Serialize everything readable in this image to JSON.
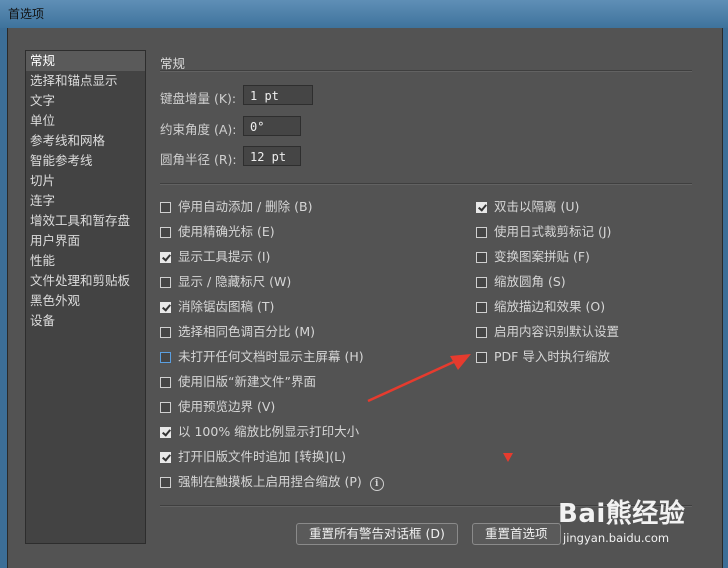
{
  "window": {
    "title": "首选项"
  },
  "sidebar": {
    "items": [
      {
        "label": "常规"
      },
      {
        "label": "选择和锚点显示"
      },
      {
        "label": "文字"
      },
      {
        "label": "单位"
      },
      {
        "label": "参考线和网格"
      },
      {
        "label": "智能参考线"
      },
      {
        "label": "切片"
      },
      {
        "label": "连字"
      },
      {
        "label": "增效工具和暂存盘"
      },
      {
        "label": "用户界面"
      },
      {
        "label": "性能"
      },
      {
        "label": "文件处理和剪贴板"
      },
      {
        "label": "黑色外观"
      },
      {
        "label": "设备"
      }
    ]
  },
  "main": {
    "section_title": "常规",
    "fields": {
      "keyboard_increment": {
        "label": "键盘增量 (K):",
        "value": "1 pt"
      },
      "constrain_angle": {
        "label": "约束角度 (A):",
        "value": "0°"
      },
      "corner_radius": {
        "label": "圆角半径 (R):",
        "value": "12 pt"
      }
    },
    "left_options": [
      {
        "label": "停用自动添加 / 删除 (B)",
        "checked": false
      },
      {
        "label": "使用精确光标 (E)",
        "checked": false
      },
      {
        "label": "显示工具提示 (I)",
        "checked": true
      },
      {
        "label": "显示 / 隐藏标尺 (W)",
        "checked": false
      },
      {
        "label": "消除锯齿图稿 (T)",
        "checked": true
      },
      {
        "label": "选择相同色调百分比 (M)",
        "checked": false
      },
      {
        "label": "未打开任何文档时显示主屏幕 (H)",
        "checked": false
      },
      {
        "label": "使用旧版“新建文件”界面",
        "checked": false
      },
      {
        "label": "使用预览边界 (V)",
        "checked": false
      },
      {
        "label": "以 100% 缩放比例显示打印大小",
        "checked": true
      },
      {
        "label": "打开旧版文件时追加 [转换](L)",
        "checked": true
      },
      {
        "label": "强制在触摸板上启用捏合缩放 (P)",
        "checked": false
      }
    ],
    "right_options": [
      {
        "label": "双击以隔离 (U)",
        "checked": true
      },
      {
        "label": "使用日式裁剪标记 (J)",
        "checked": false
      },
      {
        "label": "变换图案拼贴 (F)",
        "checked": false
      },
      {
        "label": "缩放圆角 (S)",
        "checked": false
      },
      {
        "label": "缩放描边和效果 (O)",
        "checked": false
      },
      {
        "label": "启用内容识别默认设置",
        "checked": false
      },
      {
        "label": "PDF 导入时执行缩放",
        "checked": false
      }
    ],
    "buttons": {
      "reset_warnings": "重置所有警告对话框 (D)",
      "reset_prefs": "重置首选项"
    }
  },
  "watermark": {
    "logo": "Bai熊经验",
    "url": "jingyan.baidu.com"
  },
  "colors": {
    "dialog_bg": "#535353",
    "sidebar_bg": "#434343",
    "annotation_red": "#e63b2e"
  }
}
